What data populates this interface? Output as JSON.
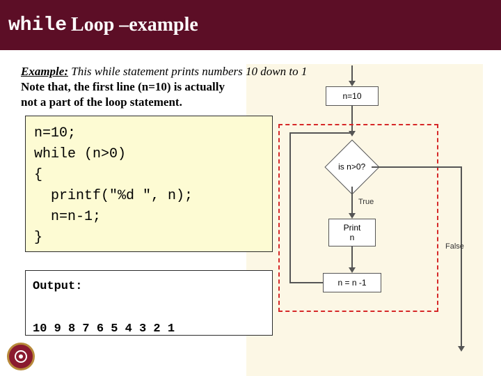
{
  "header": {
    "code": "while",
    "rest": "Loop –example"
  },
  "intro": {
    "label": "Example:",
    "text": " This while statement prints numbers 10 down to 1",
    "note1": "Note that, the first line (n=10) is  actually",
    "note2": " not a part of the loop statement."
  },
  "code": {
    "line1": "n=10;",
    "line2": "while (n>0)",
    "line3": "{",
    "line4": "  printf(\"%d \", n);",
    "line5": "  n=n-1;",
    "line6": "}"
  },
  "output": {
    "label": "Output:",
    "values": "10 9 8 7 6 5 4 3 2 1"
  },
  "flow": {
    "init": "n=10",
    "cond": "is n>0?",
    "true": "True",
    "false": "False",
    "print": "Print\nn",
    "dec": "n = n -1"
  }
}
